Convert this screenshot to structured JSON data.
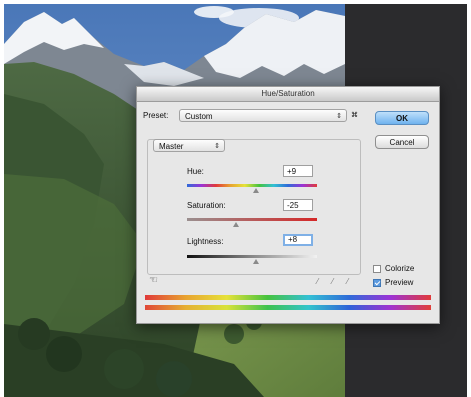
{
  "dialog": {
    "title": "Hue/Saturation",
    "preset_label": "Preset:",
    "preset_value": "Custom",
    "preset_shortcut": "⌘",
    "channel_value": "Master",
    "ok_label": "OK",
    "cancel_label": "Cancel",
    "hue": {
      "label": "Hue:",
      "value": "+9",
      "slider_fraction": 0.53
    },
    "saturation": {
      "label": "Saturation:",
      "value": "-25",
      "slider_fraction": 0.375
    },
    "lightness": {
      "label": "Lightness:",
      "value": "+8",
      "slider_fraction": 0.53
    },
    "colorize_label": "Colorize",
    "colorize_checked": false,
    "preview_label": "Preview",
    "preview_checked": true
  },
  "colors": {
    "ok_button": "#6fb2ee",
    "dark_panel": "#2b2b2d",
    "dialog_bg": "#e7e7e7"
  },
  "icons": [
    "hand-icon",
    "eyedropper-icon",
    "eyedropper-plus-icon",
    "eyedropper-minus-icon",
    "stepper-arrows-icon",
    "preset-options-icon"
  ]
}
